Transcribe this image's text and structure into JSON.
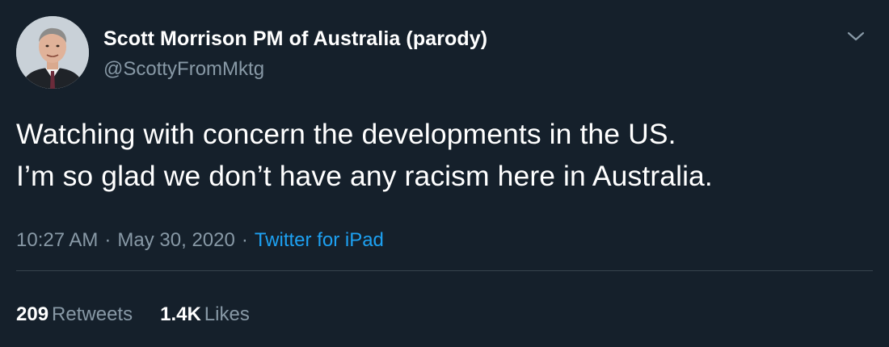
{
  "author": {
    "display_name": "Scott Morrison PM of Australia (parody)",
    "handle": "@ScottyFromMktg"
  },
  "tweet": {
    "lines": [
      "Watching with concern the developments in the US.",
      "I’m so glad we don’t have any racism here in Australia."
    ],
    "time": "10:27 AM",
    "date": "May 30, 2020",
    "separator": "·",
    "source": "Twitter for iPad"
  },
  "stats": {
    "retweets_count": "209",
    "retweets_label": "Retweets",
    "likes_count": "1.4K",
    "likes_label": "Likes"
  },
  "icons": {
    "avatar": "avatar-photo",
    "menu": "chevron-down-icon"
  },
  "colors": {
    "background": "#15202b",
    "secondary_text": "#8899a6",
    "link": "#1da1f2",
    "divider": "#38444d"
  }
}
